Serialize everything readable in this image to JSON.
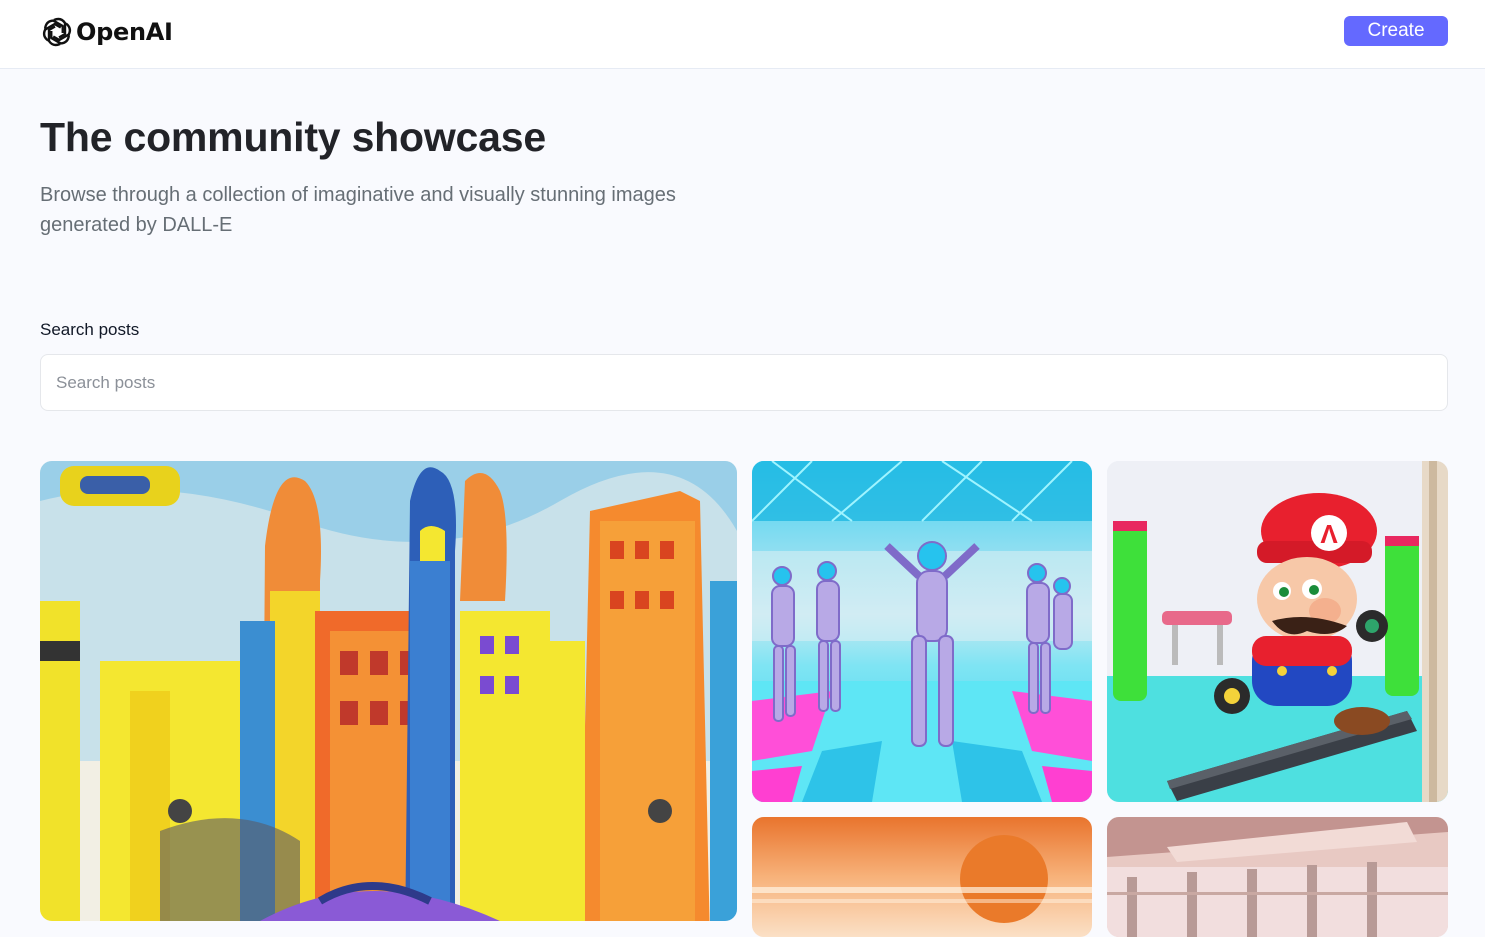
{
  "header": {
    "logo_text": "OpenAI",
    "create_label": "Create"
  },
  "hero": {
    "title": "The community showcase",
    "subtitle": "Browse through a collection of imaginative and visually stunning images generated by DALL-E"
  },
  "search": {
    "label": "Search posts",
    "placeholder": "Search posts",
    "value": ""
  },
  "gallery": {
    "cards": [
      {
        "image": "crayon-city-drawing"
      },
      {
        "image": "neon-robot-dancers"
      },
      {
        "image": "mario-gym-3d"
      },
      {
        "image": "orange-sunset"
      },
      {
        "image": "pink-room-interior"
      }
    ]
  },
  "colors": {
    "accent": "#6469ff",
    "page_bg": "#f9fafe",
    "title": "#222328",
    "subtitle": "#666e75"
  }
}
